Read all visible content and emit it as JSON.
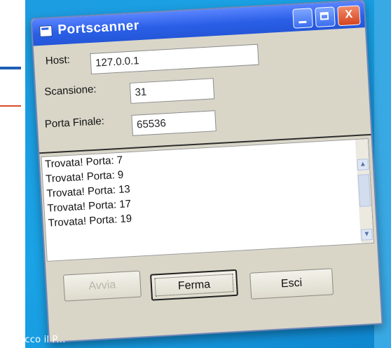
{
  "window": {
    "title": "Portscanner",
    "buttons": {
      "minimize": "minimize",
      "maximize": "maximize",
      "close": "X"
    }
  },
  "form": {
    "host_label": "Host:",
    "host_value": "127.0.0.1",
    "scansione_label": "Scansione:",
    "scansione_value": "31",
    "porta_finale_label": "Porta Finale:",
    "porta_finale_value": "65536"
  },
  "results": {
    "items": [
      "Trovata! Porta: 7",
      "Trovata! Porta: 9",
      "Trovata! Porta: 13",
      "Trovata! Porta: 17",
      "Trovata! Porta: 19"
    ]
  },
  "actions": {
    "avvia_label": "Avvia",
    "ferma_label": "Ferma",
    "esci_label": "Esci"
  },
  "caption": "Ed ecco il P...",
  "colors": {
    "background": "#1aa3e6",
    "titlebar": "#2a5fe6",
    "close_button": "#d4451f",
    "window_body": "#d9d6c8"
  },
  "icons": [
    "window-app-icon",
    "minimize-icon",
    "maximize-icon",
    "close-icon",
    "scroll-up-icon",
    "scroll-down-icon"
  ]
}
